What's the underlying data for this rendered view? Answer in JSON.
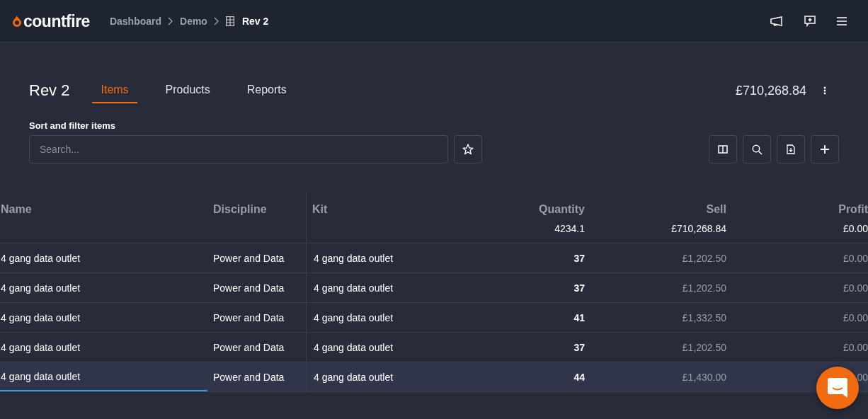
{
  "app": {
    "logo": "countfire"
  },
  "breadcrumbs": [
    {
      "label": "Dashboard",
      "current": false
    },
    {
      "label": "Demo",
      "current": false
    },
    {
      "label": "Rev 2",
      "current": true
    }
  ],
  "page": {
    "title": "Rev 2",
    "total": "£710,268.84"
  },
  "tabs": [
    {
      "label": "Items",
      "selected": true
    },
    {
      "label": "Products",
      "selected": false
    },
    {
      "label": "Reports",
      "selected": false
    }
  ],
  "filter": {
    "label": "Sort and filter items",
    "placeholder": "Search..."
  },
  "table": {
    "columns": [
      {
        "label": "Name"
      },
      {
        "label": "Discipline"
      },
      {
        "label": "Kit"
      },
      {
        "label": "Quantity",
        "total": "4234.1"
      },
      {
        "label": "Sell",
        "total": "£710,268.84"
      },
      {
        "label": "Profit",
        "total": "£0.00"
      }
    ],
    "rows": [
      {
        "cells": [
          "4 gang data outlet",
          "Power and Data",
          "4 gang data outlet",
          "37",
          "£1,202.50",
          "£0.00"
        ],
        "selected": false
      },
      {
        "cells": [
          "4 gang data outlet",
          "Power and Data",
          "4 gang data outlet",
          "37",
          "£1,202.50",
          "£0.00"
        ],
        "selected": false
      },
      {
        "cells": [
          "4 gang data outlet",
          "Power and Data",
          "4 gang data outlet",
          "41",
          "£1,332.50",
          "£0.00"
        ],
        "selected": false
      },
      {
        "cells": [
          "4 gang data outlet",
          "Power and Data",
          "4 gang data outlet",
          "37",
          "£1,202.50",
          "£0.00"
        ],
        "selected": false
      },
      {
        "cells": [
          "4 gang data outlet",
          "Power and Data",
          "4 gang data outlet",
          "44",
          "£1,430.00",
          "00"
        ],
        "selected": true
      }
    ]
  }
}
